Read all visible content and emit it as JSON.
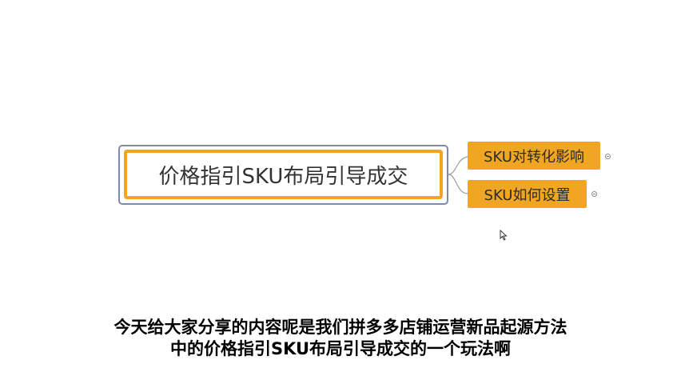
{
  "mindmap": {
    "central_topic": "价格指引SKU布局引导成交",
    "sub_topics": [
      {
        "label": "SKU对转化影响"
      },
      {
        "label": "SKU如何设置"
      }
    ],
    "colors": {
      "accent": "#f0a623",
      "frame": "#7f8aa8",
      "connector": "#9a9a9a"
    },
    "icons": {
      "expand": "expand-collapse-icon",
      "cursor": "mouse-pointer-icon"
    }
  },
  "captions": {
    "line1": "今天给大家分享的内容呢是我们拼多多店铺运营新品起源方法",
    "line2": "中的价格指引SKU布局引导成交的一个玩法啊"
  }
}
